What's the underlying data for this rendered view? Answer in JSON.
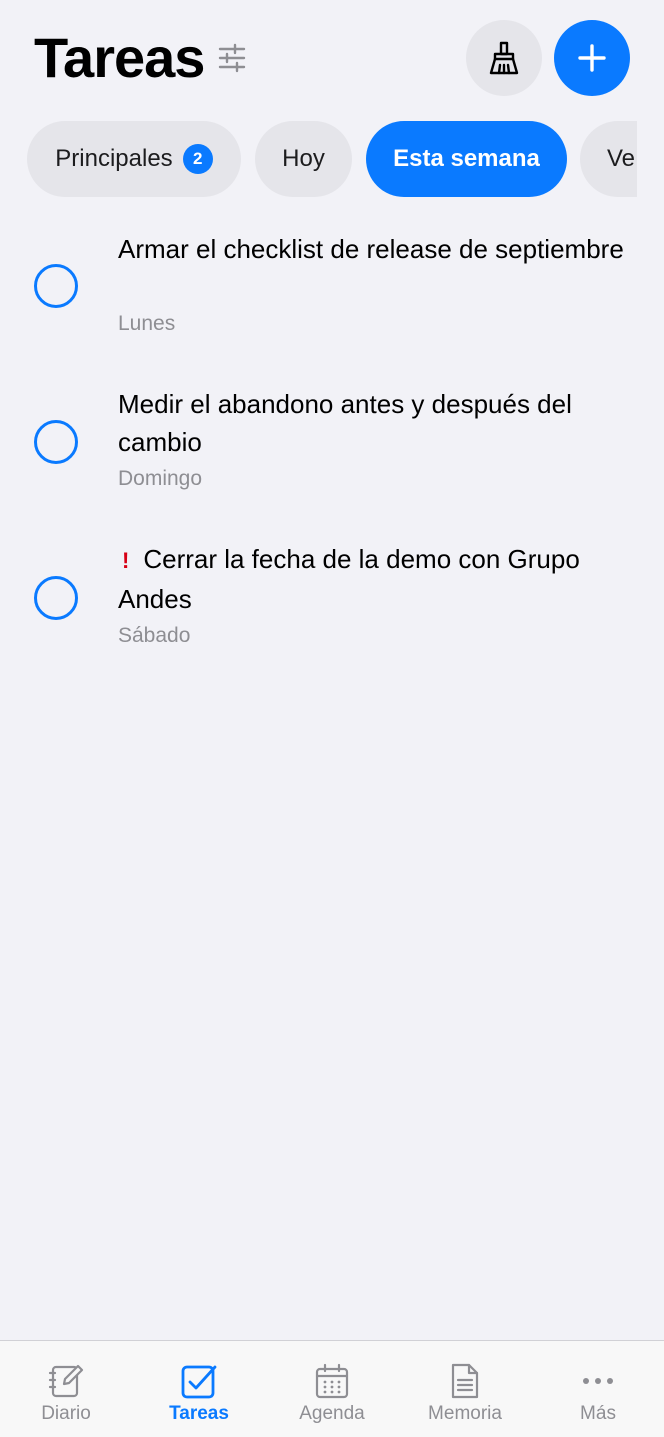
{
  "header": {
    "title": "Tareas",
    "filter_icon": "sliders-icon",
    "clean_icon": "broom-icon",
    "add_icon": "plus-icon"
  },
  "tabs": [
    {
      "label": "Principales",
      "badge": "2",
      "active": false
    },
    {
      "label": "Hoy",
      "active": false
    },
    {
      "label": "Esta semana",
      "active": true
    },
    {
      "label": "Ve",
      "active": false
    }
  ],
  "tasks": [
    {
      "title": "Armar el checklist de release de septiembre",
      "date": "Lunes",
      "priority": false
    },
    {
      "title": "Medir el abandono antes y después del cambio",
      "date": "Domingo",
      "priority": false
    },
    {
      "title": "Cerrar la fecha de la demo con Grupo Andes",
      "date": "Sábado",
      "priority": true,
      "priority_mark": "!"
    }
  ],
  "tabbar": {
    "items": [
      {
        "label": "Diario",
        "icon": "journal-icon",
        "active": false
      },
      {
        "label": "Tareas",
        "icon": "checkbox-icon",
        "active": true
      },
      {
        "label": "Agenda",
        "icon": "calendar-icon",
        "active": false
      },
      {
        "label": "Memoria",
        "icon": "document-icon",
        "active": false
      },
      {
        "label": "Más",
        "icon": "more-icon",
        "active": false
      }
    ]
  },
  "colors": {
    "accent": "#0a7aff",
    "background": "#f2f2f7",
    "secondary_text": "#8e8e93",
    "priority": "#d70015"
  }
}
